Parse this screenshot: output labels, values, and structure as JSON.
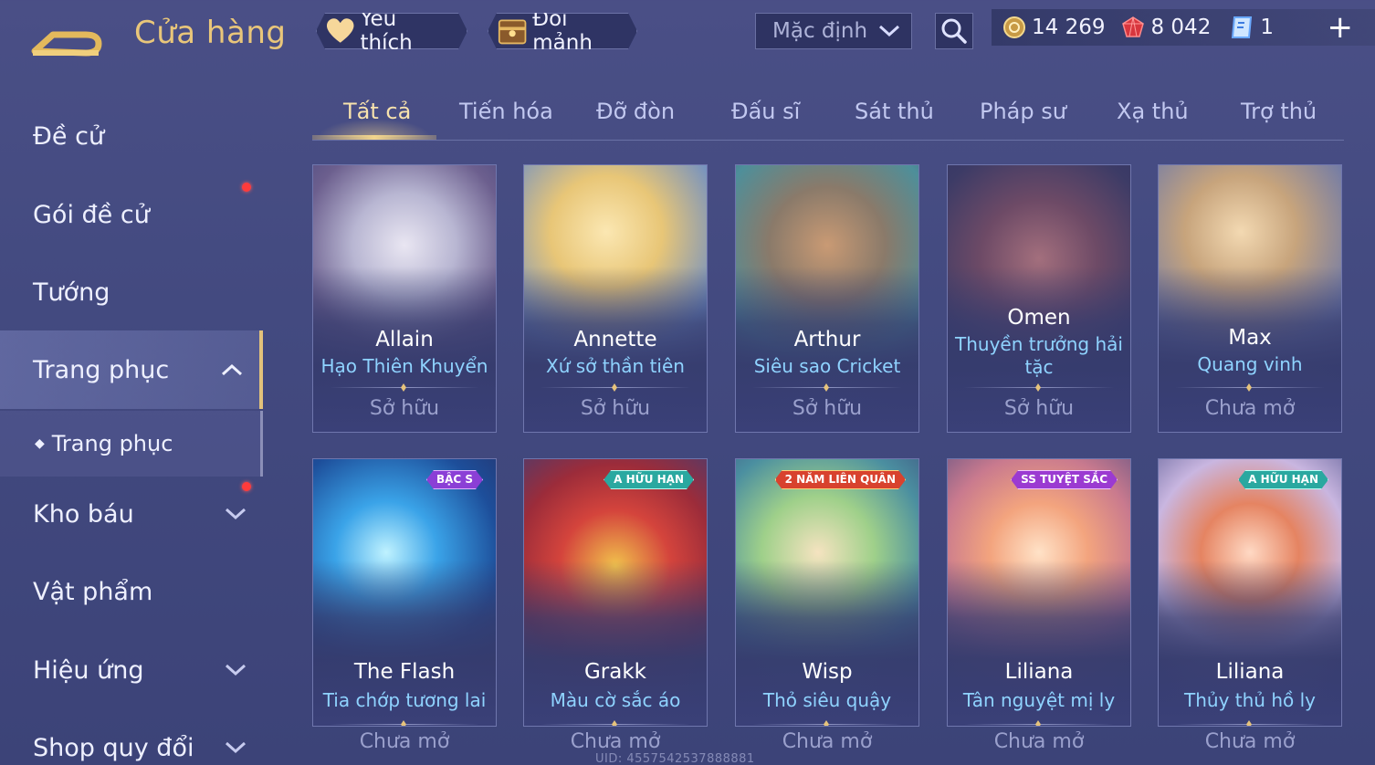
{
  "header": {
    "title": "Cửa hàng",
    "favorite_label": "Yêu thích",
    "exchange_label": "Đổi mảnh",
    "sort_value": "Mặc định",
    "currencies": {
      "gold": "14 269",
      "gems": "8 042",
      "vouchers": "1"
    },
    "plus_label": "+"
  },
  "sidebar": {
    "items": [
      {
        "label": "Đề cử"
      },
      {
        "label": "Gói đề cử"
      },
      {
        "label": "Tướng"
      },
      {
        "label": "Trang phục"
      },
      {
        "label": "Kho báu"
      },
      {
        "label": "Vật phẩm"
      },
      {
        "label": "Hiệu ứng"
      },
      {
        "label": "Shop quy đổi"
      }
    ],
    "sub_item": "Trang phục",
    "sub_bullet": "◆"
  },
  "tabs": [
    {
      "label": "Tất cả"
    },
    {
      "label": "Tiến hóa"
    },
    {
      "label": "Đỡ đòn"
    },
    {
      "label": "Đấu sĩ"
    },
    {
      "label": "Sát thủ"
    },
    {
      "label": "Pháp sư"
    },
    {
      "label": "Xạ thủ"
    },
    {
      "label": "Trợ thủ"
    }
  ],
  "cards": [
    {
      "hero": "Allain",
      "skin": "Hạo Thiên Khuyển",
      "status": "Sở hữu"
    },
    {
      "hero": "Annette",
      "skin": "Xứ sở thần tiên",
      "status": "Sở hữu"
    },
    {
      "hero": "Arthur",
      "skin": "Siêu sao Cricket",
      "status": "Sở hữu"
    },
    {
      "hero": "Omen",
      "skin": "Thuyền trưởng hải tặc",
      "status": "Sở hữu"
    },
    {
      "hero": "Max",
      "skin": "Quang vinh",
      "status": "Chưa mở"
    },
    {
      "hero": "The Flash",
      "skin": "Tia chớp tương lai",
      "status": "Chưa mở",
      "badge": "BẬC S"
    },
    {
      "hero": "Grakk",
      "skin": "Màu cờ sắc áo",
      "status": "Chưa mở",
      "badge": "A HỮU HẠN"
    },
    {
      "hero": "Wisp",
      "skin": "Thỏ siêu quậy",
      "status": "Chưa mở",
      "badge": "2 NĂM LIÊN QUÂN"
    },
    {
      "hero": "Liliana",
      "skin": "Tân nguyệt mị ly",
      "status": "Chưa mở",
      "badge": "SS TUYỆT SẮC"
    },
    {
      "hero": "Liliana",
      "skin": "Thủy thủ hồ ly",
      "status": "Chưa mở",
      "badge": "A HỮU HẠN"
    }
  ],
  "footer": {
    "uid": "UID: 4557542537888881"
  },
  "colors": {
    "accent_gold": "#e9c67a",
    "skin_name": "#8fd3ff",
    "notification": "#ff3b3b"
  },
  "icons": [
    "back-arrow-icon",
    "heart-icon",
    "chest-icon",
    "chevron-down-icon",
    "search-icon",
    "gold-coin-icon",
    "red-gem-icon",
    "voucher-icon",
    "plus-icon",
    "chevron-up-icon"
  ]
}
